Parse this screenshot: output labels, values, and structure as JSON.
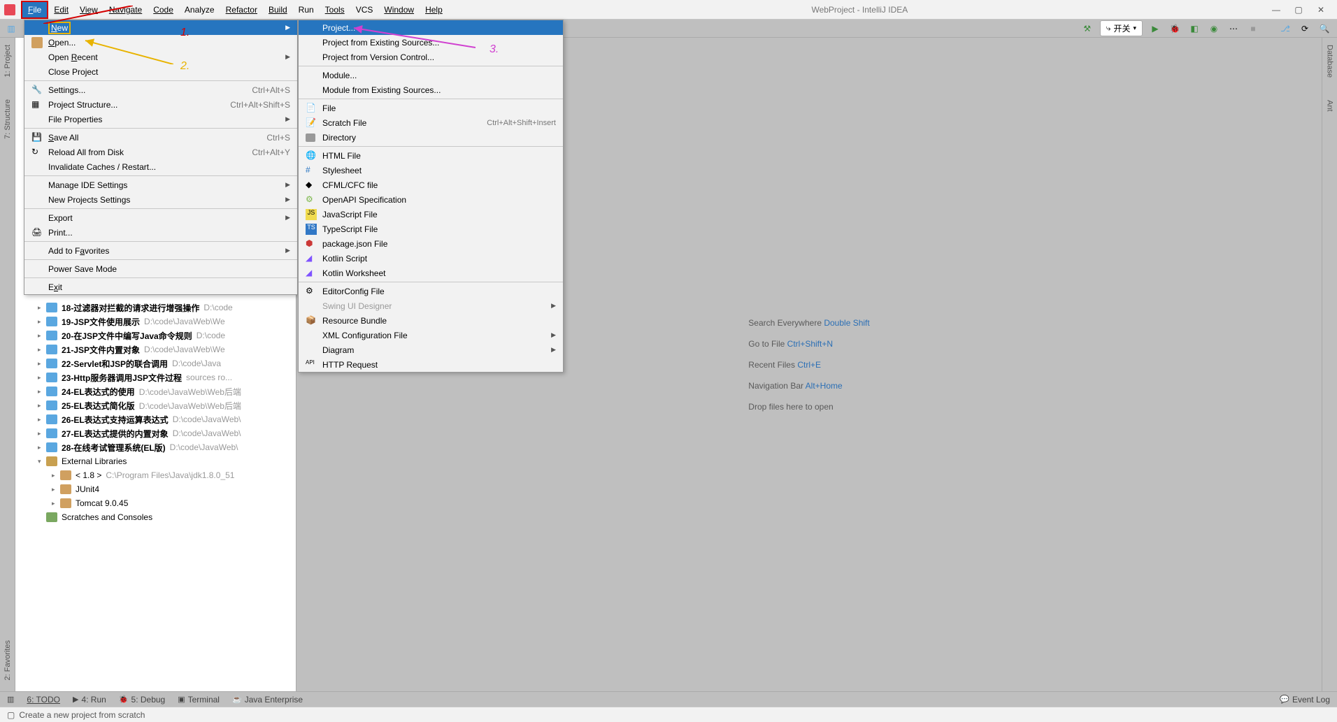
{
  "window": {
    "title": "WebProject - IntelliJ IDEA"
  },
  "menubar": {
    "file": "File",
    "edit": "Edit",
    "view": "View",
    "navigate": "Navigate",
    "code": "Code",
    "analyze": "Analyze",
    "refactor": "Refactor",
    "build": "Build",
    "run": "Run",
    "tools": "Tools",
    "vcs": "VCS",
    "window": "Window",
    "help": "Help"
  },
  "toolbar": {
    "run_config": "开关"
  },
  "left_gutter": {
    "project": "1: Project",
    "structure": "7: Structure",
    "favorites": "2: Favorites"
  },
  "right_gutter": {
    "database": "Database",
    "ant": "Ant"
  },
  "file_menu": {
    "new": "New",
    "open": "Open...",
    "open_recent": "Open Recent",
    "close_project": "Close Project",
    "settings": "Settings...",
    "settings_sc": "Ctrl+Alt+S",
    "project_structure": "Project Structure...",
    "project_structure_sc": "Ctrl+Alt+Shift+S",
    "file_properties": "File Properties",
    "save_all": "Save All",
    "save_all_sc": "Ctrl+S",
    "reload": "Reload All from Disk",
    "reload_sc": "Ctrl+Alt+Y",
    "invalidate": "Invalidate Caches / Restart...",
    "manage_ide": "Manage IDE Settings",
    "new_projects_settings": "New Projects Settings",
    "export": "Export",
    "print": "Print...",
    "add_fav": "Add to Favorites",
    "power_save": "Power Save Mode",
    "exit": "Exit"
  },
  "new_menu": {
    "project": "Project...",
    "project_existing": "Project from Existing Sources...",
    "project_vcs": "Project from Version Control...",
    "module": "Module...",
    "module_existing": "Module from Existing Sources...",
    "file": "File",
    "scratch": "Scratch File",
    "scratch_sc": "Ctrl+Alt+Shift+Insert",
    "directory": "Directory",
    "html": "HTML File",
    "stylesheet": "Stylesheet",
    "cfml": "CFML/CFC file",
    "openapi": "OpenAPI Specification",
    "js": "JavaScript File",
    "ts": "TypeScript File",
    "package_json": "package.json File",
    "kotlin_script": "Kotlin Script",
    "kotlin_ws": "Kotlin Worksheet",
    "editorconfig": "EditorConfig File",
    "swing": "Swing UI Designer",
    "resource_bundle": "Resource Bundle",
    "xml_config": "XML Configuration File",
    "diagram": "Diagram",
    "http": "HTTP Request"
  },
  "tree": {
    "items": [
      {
        "name": "18-过滤器对拦截的请求进行增强操作",
        "path": "D:\\code"
      },
      {
        "name": "19-JSP文件使用展示",
        "path": "D:\\code\\JavaWeb\\We"
      },
      {
        "name": "20-在JSP文件中编写Java命令规则",
        "path": "D:\\code"
      },
      {
        "name": "21-JSP文件内置对象",
        "path": "D:\\code\\JavaWeb\\We"
      },
      {
        "name": "22-Servlet和JSP的联合调用",
        "path": "D:\\code\\Java"
      },
      {
        "name": "23-Http服务器调用JSP文件过程",
        "path": "sources ro..."
      },
      {
        "name": "24-EL表达式的使用",
        "path": "D:\\code\\JavaWeb\\Web后端"
      },
      {
        "name": "25-EL表达式简化版",
        "path": "D:\\code\\JavaWeb\\Web后端"
      },
      {
        "name": "26-EL表达式支持运算表达式",
        "path": "D:\\code\\JavaWeb\\"
      },
      {
        "name": "27-EL表达式提供的内置对象",
        "path": "D:\\code\\JavaWeb\\"
      },
      {
        "name": "28-在线考试管理系统(EL版)",
        "path": "D:\\code\\JavaWeb\\"
      }
    ],
    "external_libs": "External Libraries",
    "jdk": "< 1.8 >",
    "jdk_path": "C:\\Program Files\\Java\\jdk1.8.0_51",
    "junit": "JUnit4",
    "tomcat": "Tomcat 9.0.45",
    "scratches": "Scratches and Consoles"
  },
  "welcome": {
    "search_label": "Search Everywhere",
    "search_key": "Double Shift",
    "goto_label": "Go to File",
    "goto_key": "Ctrl+Shift+N",
    "recent_label": "Recent Files",
    "recent_key": "Ctrl+E",
    "nav_label": "Navigation Bar",
    "nav_key": "Alt+Home",
    "drop": "Drop files here to open"
  },
  "bottom_tabs": {
    "todo": "6: TODO",
    "run": "4: Run",
    "debug": "5: Debug",
    "terminal": "Terminal",
    "java_ee": "Java Enterprise",
    "event_log": "Event Log"
  },
  "status": {
    "text": "Create a new project from scratch"
  },
  "annotations": {
    "a1": "1.",
    "a2": "2.",
    "a3": "3."
  }
}
